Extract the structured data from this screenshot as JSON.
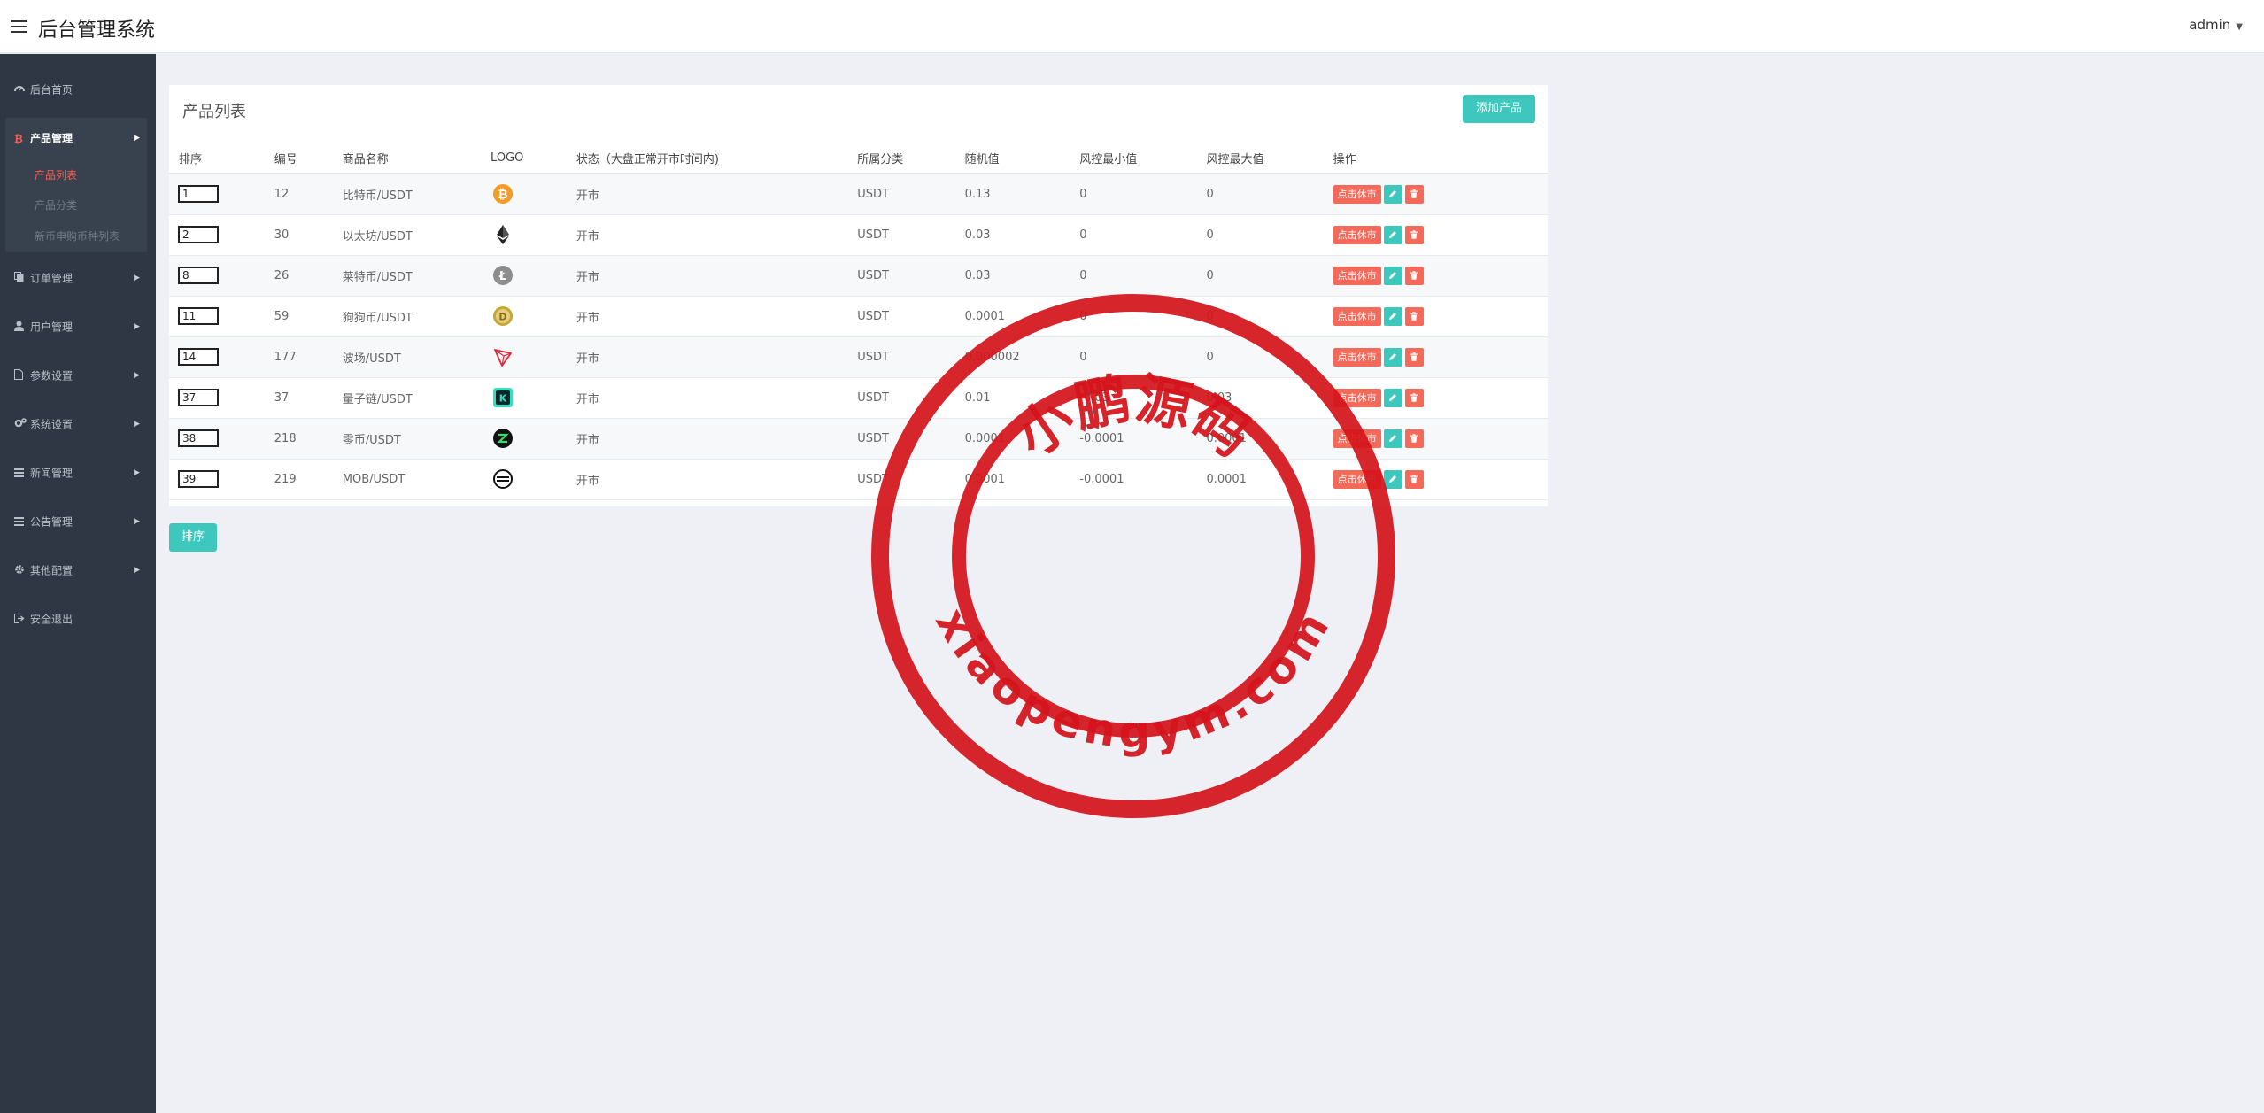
{
  "header": {
    "title": "后台管理系统",
    "user": "admin"
  },
  "sidebar": {
    "items": [
      {
        "label": "后台首页",
        "icon": "dashboard-icon"
      },
      {
        "label": "产品管理",
        "icon": "bitcoin-icon",
        "active": true,
        "children": [
          {
            "label": "产品列表",
            "current": true
          },
          {
            "label": "产品分类"
          },
          {
            "label": "新币申购币种列表"
          }
        ]
      },
      {
        "label": "订单管理",
        "icon": "copy-icon"
      },
      {
        "label": "用户管理",
        "icon": "user-icon"
      },
      {
        "label": "参数设置",
        "icon": "file-icon"
      },
      {
        "label": "系统设置",
        "icon": "cogs-icon"
      },
      {
        "label": "新闻管理",
        "icon": "list-icon"
      },
      {
        "label": "公告管理",
        "icon": "list-icon"
      },
      {
        "label": "其他配置",
        "icon": "gear-icon"
      },
      {
        "label": "安全退出",
        "icon": "sign-out-icon"
      }
    ]
  },
  "panel": {
    "title": "产品列表",
    "add_button": "添加产品",
    "columns": [
      "排序",
      "编号",
      "商品名称",
      "LOGO",
      "状态（大盘正常开市时间内)",
      "所属分类",
      "随机值",
      "风控最小值",
      "风控最大值",
      "操作"
    ],
    "rows": [
      {
        "sort": "1",
        "id": "12",
        "name": "比特币/USDT",
        "logo": "btc",
        "status": "开市",
        "category": "USDT",
        "random": "0.13",
        "risk_min": "0",
        "risk_max": "0"
      },
      {
        "sort": "2",
        "id": "30",
        "name": "以太坊/USDT",
        "logo": "eth",
        "status": "开市",
        "category": "USDT",
        "random": "0.03",
        "risk_min": "0",
        "risk_max": "0"
      },
      {
        "sort": "8",
        "id": "26",
        "name": "莱特币/USDT",
        "logo": "ltc",
        "status": "开市",
        "category": "USDT",
        "random": "0.03",
        "risk_min": "0",
        "risk_max": "0"
      },
      {
        "sort": "11",
        "id": "59",
        "name": "狗狗币/USDT",
        "logo": "doge",
        "status": "开市",
        "category": "USDT",
        "random": "0.0001",
        "risk_min": "0",
        "risk_max": "0"
      },
      {
        "sort": "14",
        "id": "177",
        "name": "波场/USDT",
        "logo": "trx",
        "status": "开市",
        "category": "USDT",
        "random": "0.000002",
        "risk_min": "0",
        "risk_max": "0"
      },
      {
        "sort": "37",
        "id": "37",
        "name": "量子链/USDT",
        "logo": "qtum",
        "status": "开市",
        "category": "USDT",
        "random": "0.01",
        "risk_min": "-0.03",
        "risk_max": "0.03"
      },
      {
        "sort": "38",
        "id": "218",
        "name": "零币/USDT",
        "logo": "zec",
        "status": "开市",
        "category": "USDT",
        "random": "0.0001",
        "risk_min": "-0.0001",
        "risk_max": "0.0001"
      },
      {
        "sort": "39",
        "id": "219",
        "name": "MOB/USDT",
        "logo": "mob",
        "status": "开市",
        "category": "USDT",
        "random": "0.0001",
        "risk_min": "-0.0001",
        "risk_max": "0.0001"
      }
    ],
    "row_actions": {
      "close_label": "点击休市",
      "edit_icon": "pencil-icon",
      "delete_icon": "trash-icon"
    }
  },
  "sort_button": "排序",
  "watermark": {
    "top_text": "小鹏源码",
    "bottom_text": "xiaopengym.com",
    "color": "#d4141c"
  },
  "colors": {
    "accent": "#3ec7bd",
    "danger": "#f36a5a",
    "sidebar": "#2e3743",
    "active_text": "#ff5a4f"
  }
}
